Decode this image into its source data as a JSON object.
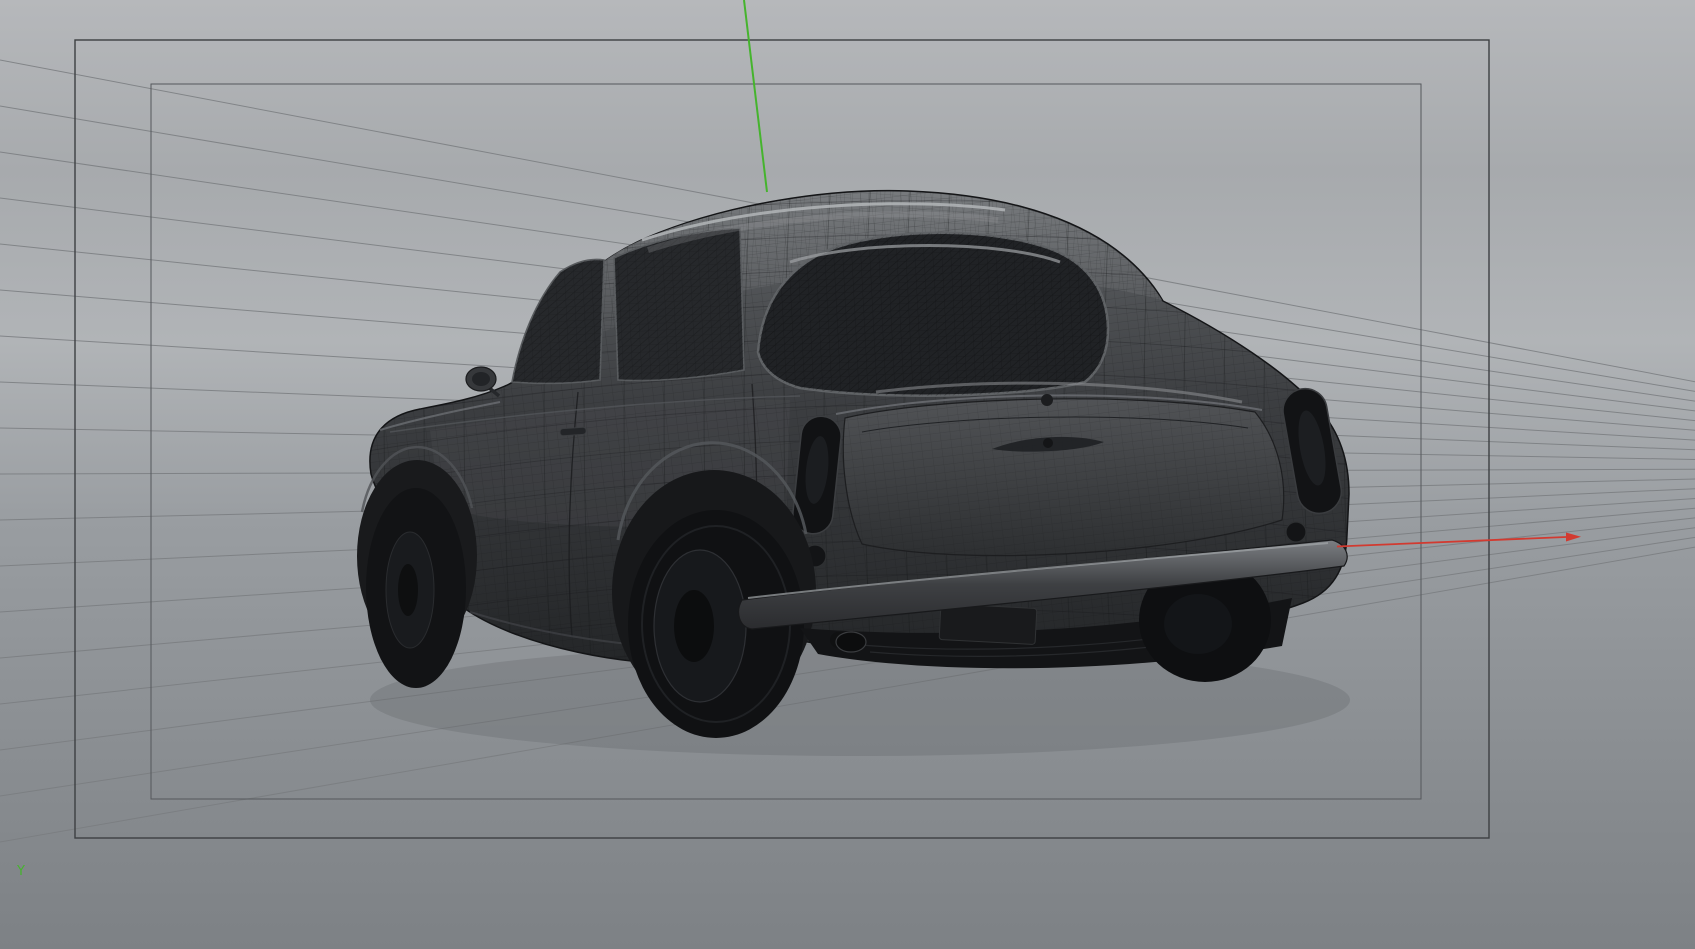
{
  "viewport": {
    "axis_gizmo": {
      "y_label": "Y"
    },
    "colors": {
      "bg_top": "#b6b8bb",
      "bg_upper": "#a7aaad",
      "bg_mid": "#b1b4b7",
      "bg_lower": "#999da1",
      "bg_bottom": "#7d8185",
      "grid_line": "#7a7d80",
      "frame_outer": "#3c3f42",
      "frame_inner": "#54575b",
      "y_axis": "#45b42d",
      "x_axis": "#d23a30",
      "car_body": "#3d3f42",
      "glass": "#1f2124",
      "chrome": "#8e9194"
    }
  }
}
